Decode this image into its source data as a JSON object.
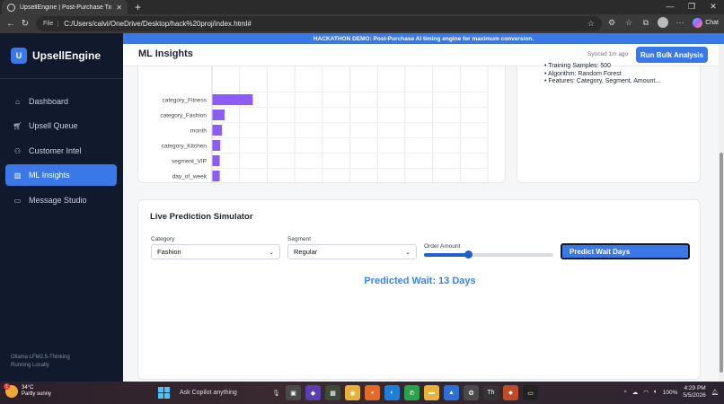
{
  "browser": {
    "tab_title": "UpsellEngine | Post-Purchase Timi…",
    "url_prefix": "File",
    "url": "C:/Users/calvi/OneDrive/Desktop/hack%20proj/index.html#",
    "chat_label": "Chat"
  },
  "sidebar": {
    "logo_letter": "U",
    "app_name": "UpsellEngine",
    "items": [
      {
        "label": "Dashboard",
        "icon": "home-icon"
      },
      {
        "label": "Upsell Queue",
        "icon": "cart-icon"
      },
      {
        "label": "Customer Intel",
        "icon": "users-icon"
      },
      {
        "label": "ML Insights",
        "icon": "bar-chart-icon",
        "active": true
      },
      {
        "label": "Message Studio",
        "icon": "message-icon"
      }
    ],
    "footer_line1": "Ollama LFM2.5-Thinking",
    "footer_line2": "Running Locally"
  },
  "banner": "HACKATHON DEMO: Post-Purchase AI timing engine for maximum conversion.",
  "header": {
    "title": "ML Insights",
    "synced": "Synced 1m ago",
    "bulk_button": "Run Bulk Analysis"
  },
  "model_info": [
    "Training Samples: 500",
    "Algorithm: Random Forest",
    "Features: Category, Segment, Amount..."
  ],
  "chart_data": {
    "type": "bar",
    "orientation": "horizontal",
    "categories": [
      "category_Fitness",
      "category_Fashion",
      "month",
      "category_Kitchen",
      "segment_VIP",
      "day_of_week"
    ],
    "values": [
      0.074,
      0.023,
      0.018,
      0.015,
      0.014,
      0.014
    ],
    "xlim": [
      0,
      0.5
    ],
    "xticks": [
      "0",
      "0.05",
      "0.10",
      "0.15",
      "0.20",
      "0.25",
      "0.30",
      "0.35",
      "0.40",
      "0.45",
      "0.50"
    ],
    "grid": true,
    "bar_color": "#8b5cf6"
  },
  "simulator": {
    "title": "Live Prediction Simulator",
    "category_label": "Category",
    "category_value": "Fashion",
    "segment_label": "Segment",
    "segment_value": "Regular",
    "amount_label": "Order Amount",
    "amount_level": 0.34,
    "predict_button": "Predict Wait Days",
    "result": "Predicted Wait: 13 Days"
  },
  "taskbar": {
    "temp": "34°C",
    "weather": "Partly sunny",
    "badge": "1",
    "search": "Ask Copilot anything",
    "battery": "100%",
    "time": "4:29 PM",
    "date": "5/5/2026"
  },
  "colors": {
    "accent": "#3b78e7",
    "sidebar_bg": "#101a2c",
    "result_text": "#3b82f6"
  }
}
